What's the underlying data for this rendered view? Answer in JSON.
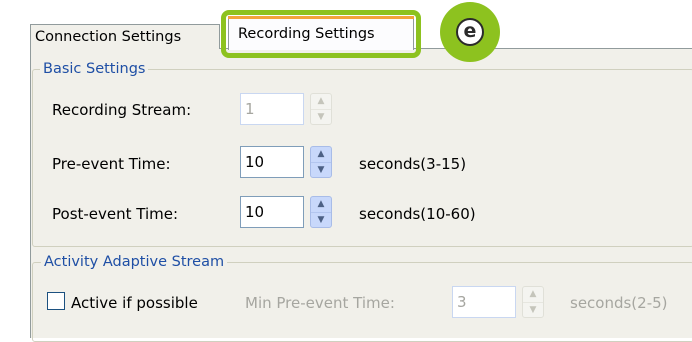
{
  "tabs": [
    {
      "label": "Connection Settings",
      "active": false
    },
    {
      "label": "Recording Settings",
      "active": true
    }
  ],
  "annotation": {
    "letter": "e",
    "color": "#8dc21f"
  },
  "basic": {
    "title": "Basic Settings",
    "recording_stream": {
      "label": "Recording Stream:",
      "value": "1",
      "enabled": false
    },
    "pre_event": {
      "label": "Pre-event Time:",
      "value": "10",
      "unit": "seconds(3-15)"
    },
    "post_event": {
      "label": "Post-event Time:",
      "value": "10",
      "unit": "seconds(10-60)"
    }
  },
  "activity": {
    "title": "Activity Adaptive Stream",
    "checkbox_label": "Active if possible",
    "checked": false,
    "min_pre_event": {
      "label": "Min Pre-event Time:",
      "value": "3",
      "unit": "seconds(2-5)",
      "enabled": false
    }
  },
  "icons": {
    "up": "spin-up-arrow-icon",
    "down": "spin-down-arrow-icon"
  }
}
